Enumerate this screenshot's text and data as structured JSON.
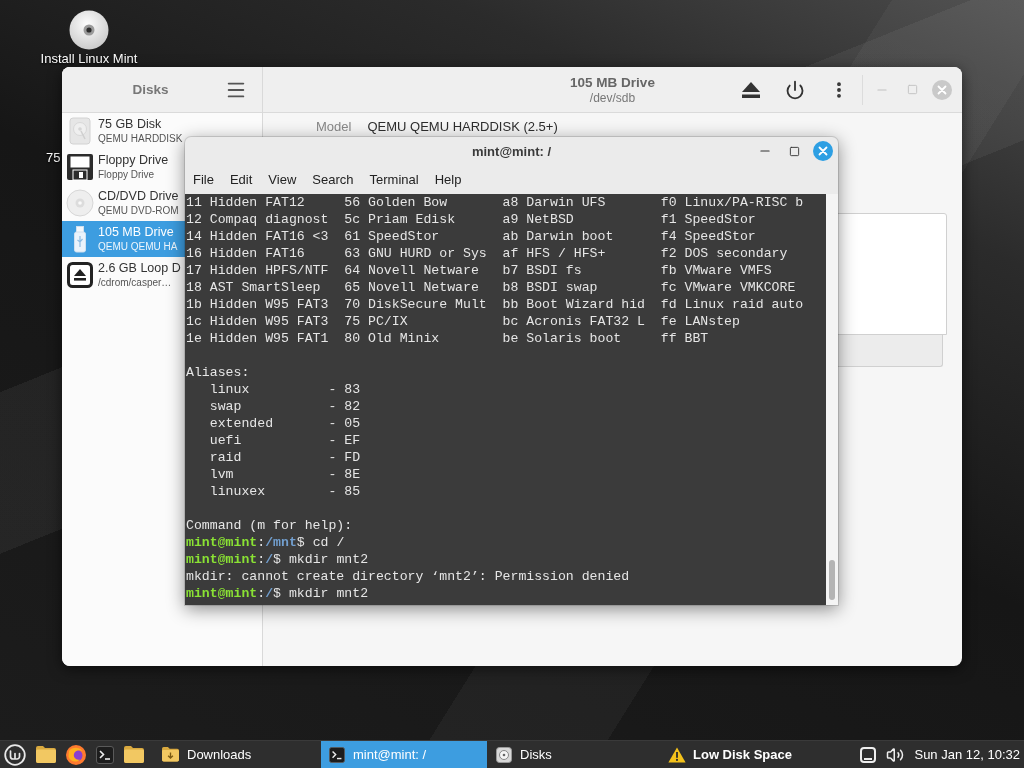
{
  "desktop": {
    "icons": [
      {
        "kind": "disc",
        "label": "Install Linux Mint"
      },
      {
        "kind": "label_only",
        "label": "75"
      }
    ]
  },
  "disks_window": {
    "sidebar_title": "Disks",
    "drives": [
      {
        "kind": "harddisk",
        "name": "75 GB Disk",
        "detail": "QEMU HARDDISK",
        "selected": false
      },
      {
        "kind": "floppy",
        "name": "Floppy Drive",
        "detail": "Floppy Drive",
        "selected": false
      },
      {
        "kind": "optical",
        "name": "CD/DVD Drive",
        "detail": "QEMU DVD-ROM",
        "selected": false
      },
      {
        "kind": "usb",
        "name": "105 MB Drive",
        "detail": "QEMU QEMU HA",
        "selected": true
      },
      {
        "kind": "loop",
        "name": "2.6 GB Loop D",
        "detail": "/cdrom/casper…",
        "selected": false
      }
    ],
    "title": "105 MB Drive",
    "subtitle": "/dev/sdb",
    "model_label": "Model",
    "model_value": "QEMU QEMU HARDDISK (2.5+)"
  },
  "terminal_window": {
    "title": "mint@mint: /",
    "menu": [
      "File",
      "Edit",
      "View",
      "Search",
      "Terminal",
      "Help"
    ],
    "partition_types": [
      [
        "11 Hidden FAT12",
        "56 Golden Bow",
        "a8 Darwin UFS",
        "f0 Linux/PA-RISC b"
      ],
      [
        "12 Compaq diagnost",
        "5c Priam Edisk",
        "a9 NetBSD",
        "f1 SpeedStor"
      ],
      [
        "14 Hidden FAT16 <3",
        "61 SpeedStor",
        "ab Darwin boot",
        "f4 SpeedStor"
      ],
      [
        "16 Hidden FAT16",
        "63 GNU HURD or Sys",
        "af HFS / HFS+",
        "f2 DOS secondary"
      ],
      [
        "17 Hidden HPFS/NTF",
        "64 Novell Netware",
        "b7 BSDI fs",
        "fb VMware VMFS"
      ],
      [
        "18 AST SmartSleep",
        "65 Novell Netware",
        "b8 BSDI swap",
        "fc VMware VMKCORE"
      ],
      [
        "1b Hidden W95 FAT3",
        "70 DiskSecure Mult",
        "bb Boot Wizard hid",
        "fd Linux raid auto"
      ],
      [
        "1c Hidden W95 FAT3",
        "75 PC/IX",
        "bc Acronis FAT32 L",
        "fe LANstep"
      ],
      [
        "1e Hidden W95 FAT1",
        "80 Old Minix",
        "be Solaris boot",
        "ff BBT"
      ]
    ],
    "aliases_heading": "Aliases:",
    "aliases": [
      {
        "name": "linux",
        "code": "- 83"
      },
      {
        "name": "swap",
        "code": "- 82"
      },
      {
        "name": "extended",
        "code": "- 05"
      },
      {
        "name": "uefi",
        "code": "- EF"
      },
      {
        "name": "raid",
        "code": "- FD"
      },
      {
        "name": "lvm",
        "code": "- 8E"
      },
      {
        "name": "linuxex",
        "code": "- 85"
      }
    ],
    "lines": [
      {
        "kind": "output",
        "text": "Command (m for help):"
      },
      {
        "kind": "prompt",
        "user_host": "mint@mint",
        "separator": ":",
        "path": "/mnt",
        "command": "$ cd /"
      },
      {
        "kind": "prompt",
        "user_host": "mint@mint",
        "separator": ":",
        "path": "/",
        "command": "$ mkdir mnt2"
      },
      {
        "kind": "output",
        "text": "mkdir: cannot create directory ‘mnt2’: Permission denied"
      },
      {
        "kind": "prompt",
        "user_host": "mint@mint",
        "separator": ":",
        "path": "/",
        "command": "$ mkdir mnt2"
      }
    ]
  },
  "taskbar": {
    "windows": [
      {
        "kind": "folder",
        "label": "Downloads",
        "selected": false
      },
      {
        "kind": "terminal",
        "label": "mint@mint: /",
        "selected": true
      },
      {
        "kind": "disks",
        "label": "Disks",
        "selected": false
      }
    ],
    "notification": "Low Disk Space",
    "clock": "Sun Jan 12, 10:32"
  }
}
